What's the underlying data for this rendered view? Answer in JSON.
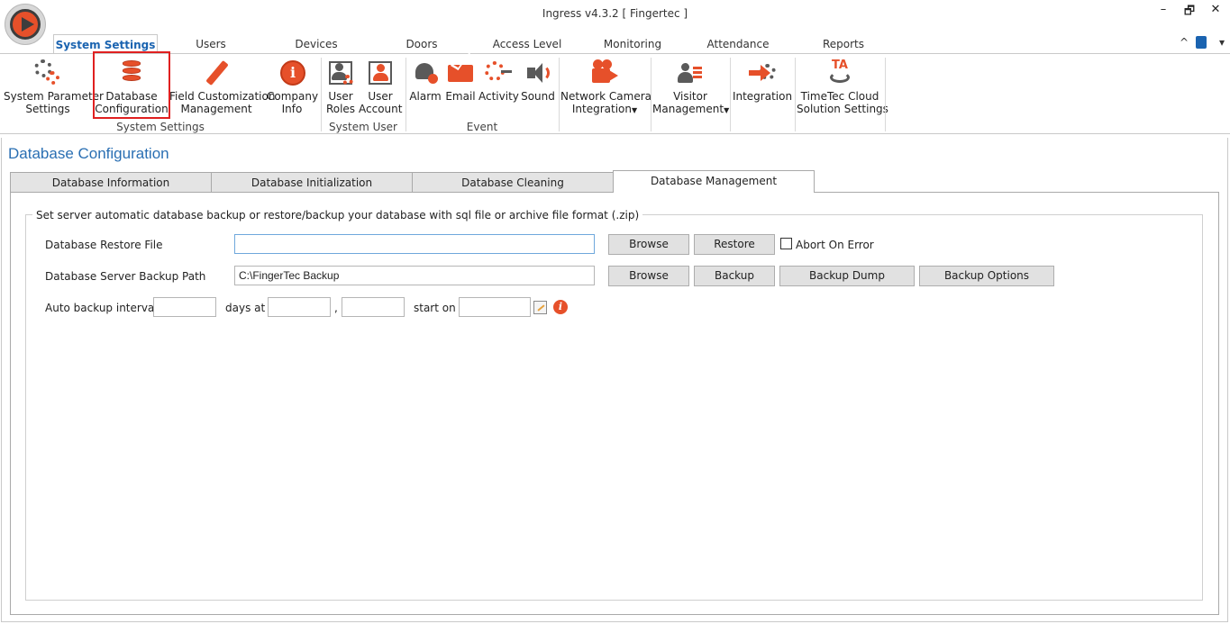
{
  "window": {
    "title": "Ingress v4.3.2 [ Fingertec ]",
    "minimize": "–",
    "restore": "🗗",
    "close": "✕"
  },
  "main_tabs": [
    {
      "label": "System Settings",
      "active": true
    },
    {
      "label": "Users"
    },
    {
      "label": "Devices"
    },
    {
      "label": "Doors"
    },
    {
      "label": "Access Level"
    },
    {
      "label": "Monitoring"
    },
    {
      "label": "Attendance"
    },
    {
      "label": "Reports"
    }
  ],
  "ribbon_controls": {
    "collapse": "^",
    "dropdown": "▾"
  },
  "ribbon": {
    "system_settings": {
      "group_label": "System Settings",
      "items": [
        {
          "label1": "System Parameter",
          "label2": "Settings",
          "icon": "gears-icon"
        },
        {
          "label1": "Database",
          "label2": "Configuration",
          "icon": "database-icon"
        },
        {
          "label1": "Field Customization",
          "label2": "Management",
          "icon": "pencil-icon"
        },
        {
          "label1": "Company",
          "label2": "Info",
          "icon": "info-icon"
        }
      ]
    },
    "system_user": {
      "group_label": "System User",
      "items": [
        {
          "label1": "User",
          "label2": "Roles",
          "icon": "user-roles-icon"
        },
        {
          "label1": "User",
          "label2": "Account",
          "icon": "user-account-icon"
        }
      ]
    },
    "event": {
      "group_label": "Event",
      "items": [
        {
          "label1": "Alarm",
          "icon": "alarm-icon"
        },
        {
          "label1": "Email",
          "icon": "email-icon"
        },
        {
          "label1": "Activity",
          "icon": "activity-icon"
        },
        {
          "label1": "Sound",
          "icon": "sound-icon"
        }
      ]
    },
    "network_camera": {
      "label1": "Network Camera",
      "label2": "Integration",
      "icon": "camera-icon"
    },
    "visitor": {
      "label1": "Visitor",
      "label2": "Management",
      "icon": "visitor-icon"
    },
    "integration": {
      "label1": "Integration",
      "icon": "integration-icon"
    },
    "timetec": {
      "label1": "TimeTec Cloud",
      "label2": "Solution Settings",
      "icon": "timetec-icon",
      "logo_text": "TA"
    }
  },
  "page": {
    "title": "Database Configuration",
    "sub_tabs": [
      {
        "label": "Database Information"
      },
      {
        "label": "Database Initialization"
      },
      {
        "label": "Database Cleaning"
      },
      {
        "label": "Database Management",
        "active": true
      }
    ],
    "group_title": "Set server automatic database backup or restore/backup your database with sql file or archive file format (.zip)",
    "restore": {
      "label": "Database Restore File",
      "value": "",
      "browse": "Browse",
      "restore": "Restore",
      "abort_on_error": "Abort On Error"
    },
    "backup": {
      "label": "Database Server Backup Path",
      "value": "C:\\FingerTec Backup",
      "browse": "Browse",
      "backup": "Backup",
      "backup_dump": "Backup Dump",
      "backup_options": "Backup Options"
    },
    "auto": {
      "label": "Auto backup interval",
      "interval": "",
      "days_at": "days at",
      "hour": "",
      "comma": ",",
      "minute": "",
      "start_on": "start on",
      "start_date": "",
      "info_glyph": "i"
    }
  }
}
